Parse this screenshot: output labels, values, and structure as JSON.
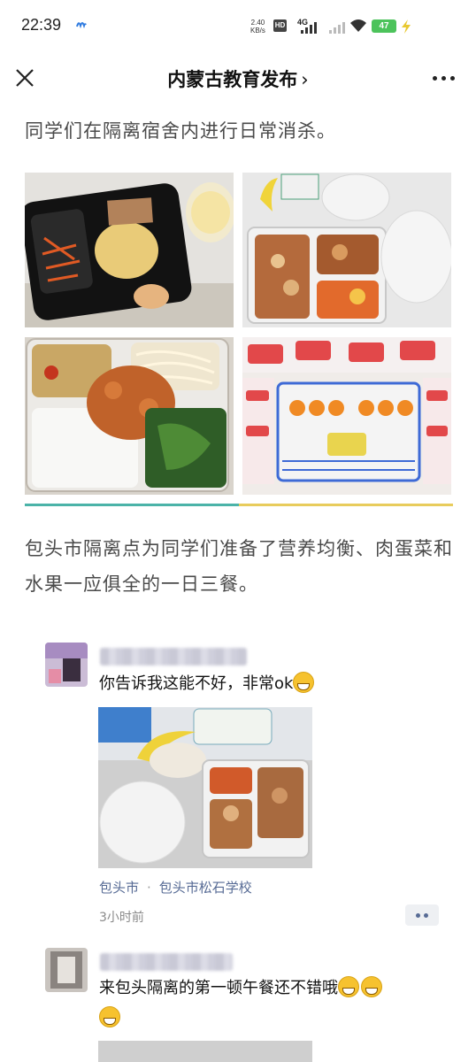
{
  "status": {
    "time": "22:39",
    "speed_value": "2.40",
    "speed_unit": "KB/s",
    "hd": "HD",
    "network": "4G",
    "battery": "47"
  },
  "nav": {
    "title": "内蒙古教育发布",
    "chevron": "›"
  },
  "article": {
    "para1": "同学们在隔离宿舍内进行日常消杀。",
    "para2": "包头市隔离点为同学们准备了营养均衡、肉蛋菜和水果一应俱全的一日三餐。"
  },
  "posts": [
    {
      "comment": "你告诉我这能不好，非常ok",
      "location_city": "包头市",
      "location_sep": "·",
      "location_place": "包头市松石学校",
      "time_ago": "3小时前"
    },
    {
      "comment_line1": "来包头隔离的第一顿午餐还不错哦"
    }
  ],
  "icons": [
    "close-icon",
    "more-icon",
    "wifi-icon",
    "signal-icon",
    "battery-icon"
  ],
  "colors": {
    "link": "#576b95",
    "divider_left": "#4bb3a8",
    "divider_right": "#e8cc5c",
    "battery": "#4cc35b"
  }
}
